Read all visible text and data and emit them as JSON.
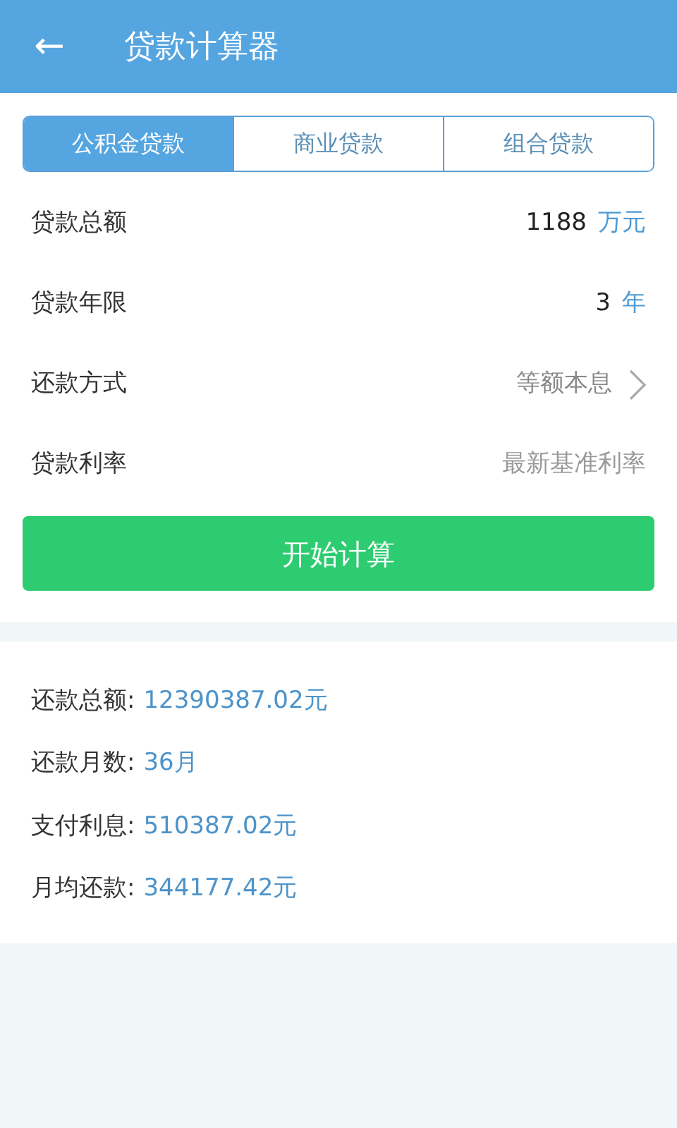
{
  "header": {
    "back": "←",
    "title": "贷款计算器"
  },
  "tabs": [
    {
      "label": "公积金贷款",
      "selected": true
    },
    {
      "label": "商业贷款",
      "selected": false
    },
    {
      "label": "组合贷款",
      "selected": false
    }
  ],
  "form": [
    {
      "kind": "input",
      "label": "贷款总额",
      "value": "1188",
      "unit": "万元"
    },
    {
      "kind": "input",
      "label": "贷款年限",
      "value": "3",
      "unit": "年"
    },
    {
      "kind": "select",
      "label": "还款方式",
      "value": "等额本息"
    },
    {
      "kind": "text",
      "label": "贷款利率",
      "value": "最新基准利率"
    }
  ],
  "calculate_button": "开始计算",
  "results": [
    {
      "label": "还款总额:",
      "value": "12390387.02元"
    },
    {
      "label": "还款月数:",
      "value": "36月"
    },
    {
      "label": "支付利息:",
      "value": "510387.02元"
    },
    {
      "label": "月均还款:",
      "value": "344177.42元"
    }
  ]
}
